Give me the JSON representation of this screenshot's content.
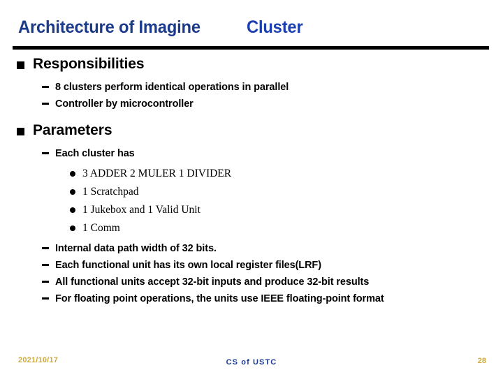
{
  "slide": {
    "title": {
      "main": "Architecture of Imagine",
      "sub": "Cluster",
      "color_main": "#1b3a8c",
      "color_sub": "#1c3fb0"
    },
    "rule_color": "#000000",
    "sections": [
      {
        "heading": "Responsibilities",
        "bullet": "square-bullet",
        "items": [
          {
            "level": 2,
            "bullet": "dash-bullet",
            "text": "8 clusters perform identical operations in parallel"
          },
          {
            "level": 2,
            "bullet": "dash-bullet",
            "text": "Controller by microcontroller"
          }
        ]
      },
      {
        "heading": "Parameters",
        "bullet": "square-bullet",
        "items": [
          {
            "level": 2,
            "bullet": "dash-bullet",
            "text": "Each cluster has"
          },
          {
            "level": 3,
            "bullet": "round-bullet",
            "text": "3 ADDER 2 MULER 1 DIVIDER"
          },
          {
            "level": 3,
            "bullet": "round-bullet",
            "text": "1 Scratchpad"
          },
          {
            "level": 3,
            "bullet": "round-bullet",
            "text": "1 Jukebox and 1 Valid Unit"
          },
          {
            "level": 3,
            "bullet": "round-bullet",
            "text": "1 Comm"
          },
          {
            "level": 2,
            "bullet": "dash-bullet",
            "text": "Internal data path width of 32 bits."
          },
          {
            "level": 2,
            "bullet": "dash-bullet",
            "text": "Each functional unit has its own local register files(LRF)"
          },
          {
            "level": 2,
            "bullet": "dash-bullet",
            "text": "All functional units accept 32-bit inputs and produce 32-bit results"
          },
          {
            "level": 2,
            "bullet": "dash-bullet",
            "text": "For floating point operations, the units use IEEE floating-point format"
          }
        ]
      }
    ],
    "footer": {
      "date": "2021/10/17",
      "center": "CS of USTC",
      "page_number": "28",
      "date_color": "#cfa93a",
      "center_color": "#1b3a8c"
    }
  }
}
